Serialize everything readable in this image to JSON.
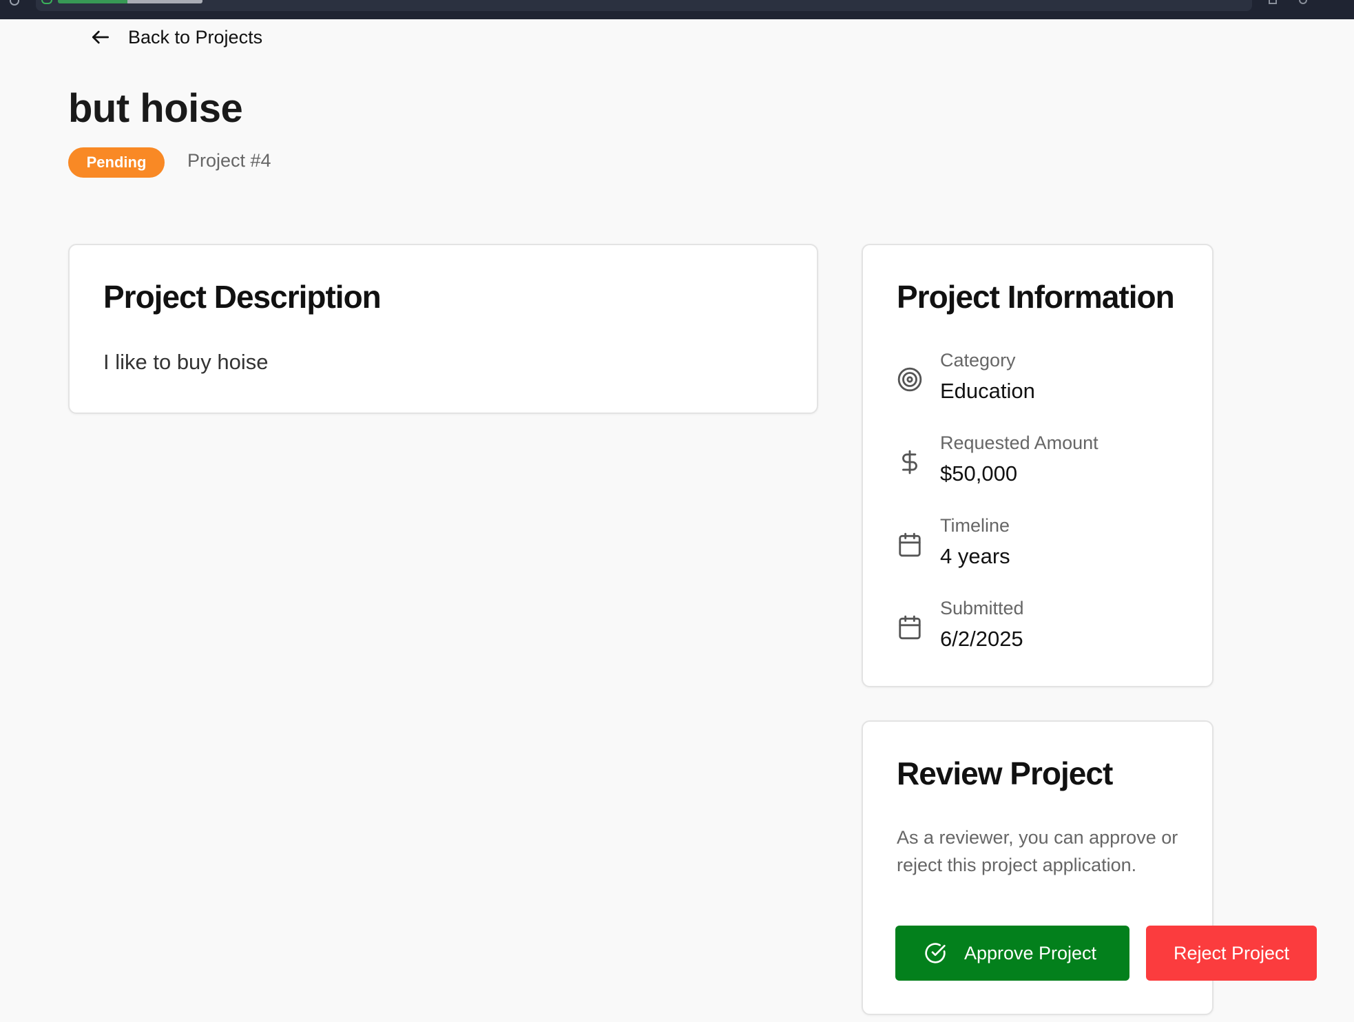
{
  "nav": {
    "back_label": "Back to Projects"
  },
  "project": {
    "title": "but hoise",
    "status": "Pending",
    "number": "Project #4"
  },
  "description": {
    "heading": "Project Description",
    "text": "I like to buy hoise"
  },
  "info": {
    "heading": "Project Information",
    "rows": [
      {
        "icon": "target-icon",
        "label": "Category",
        "value": "Education"
      },
      {
        "icon": "dollar-icon",
        "label": "Requested Amount",
        "value": "$50,000"
      },
      {
        "icon": "calendar-icon",
        "label": "Timeline",
        "value": "4 years"
      },
      {
        "icon": "calendar-icon",
        "label": "Submitted",
        "value": "6/2/2025"
      }
    ]
  },
  "review": {
    "heading": "Review Project",
    "text": "As a reviewer, you can approve or reject this project application.",
    "approve_label": "Approve Project",
    "reject_label": "Reject Project"
  },
  "colors": {
    "pending_badge": "#f98925",
    "approve": "#03801c",
    "reject": "#fb3c3e",
    "background": "#f9f9f9"
  }
}
